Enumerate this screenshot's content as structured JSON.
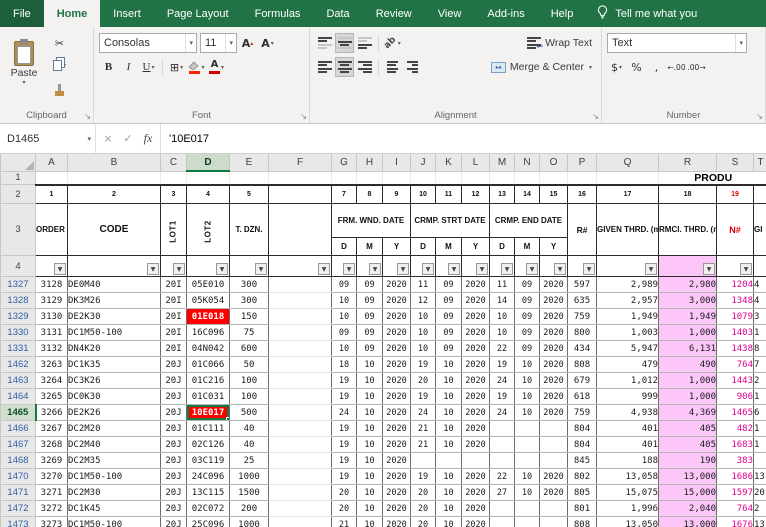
{
  "tabs": {
    "items": [
      "File",
      "Home",
      "Insert",
      "Page Layout",
      "Formulas",
      "Data",
      "Review",
      "View",
      "Add-ins",
      "Help"
    ],
    "active": "Home",
    "tell_me": "Tell me what you"
  },
  "ribbon": {
    "clipboard": {
      "label": "Clipboard",
      "paste": "Paste"
    },
    "font": {
      "label": "Font",
      "name": "Consolas",
      "size": "11",
      "bold": "B",
      "italic": "I",
      "underline": "U"
    },
    "alignment": {
      "label": "Alignment",
      "wrap": "Wrap Text",
      "merge": "Merge & Center"
    },
    "number": {
      "label": "Number",
      "format": "Text"
    }
  },
  "formula_bar": {
    "name_box": "D1465",
    "cancel": "×",
    "enter": "✓",
    "fx": "fx",
    "formula": "'10E017"
  },
  "icons": {
    "caret": "▾",
    "caret_up": "▴",
    "launcher": "↘",
    "cut": "✂",
    "borders": "⊞",
    "accounting": "$",
    "percent": "%",
    "comma": ",",
    "inc_decimal": "←.00",
    "dec_decimal": ".00→",
    "orientation": "ab",
    "filter": "▼",
    "merge_arrow": "↔",
    "inc_font": "A",
    "dec_font": "A"
  },
  "colors": {
    "excel_green": "#217346",
    "selection_green": "#107c41",
    "cell_fill_red": "#ff0000",
    "rmci_column_pink": "#fcc7f8",
    "n_column_magenta": "#e0008c",
    "filtered_row_number_blue": "#2e5fa3",
    "header_red": "#e10000"
  },
  "sheet": {
    "selected": {
      "col": "D",
      "row": "1465"
    },
    "title_partial": "PRODU",
    "header_row_nums": [
      "1",
      "2",
      "3",
      "4"
    ],
    "columns": [
      {
        "l": "A",
        "w": 32
      },
      {
        "l": "B",
        "w": 93
      },
      {
        "l": "C",
        "w": 26
      },
      {
        "l": "D",
        "w": 43
      },
      {
        "l": "E",
        "w": 39
      },
      {
        "l": "F",
        "w": 63
      },
      {
        "l": "G",
        "w": 25
      },
      {
        "l": "H",
        "w": 26
      },
      {
        "l": "I",
        "w": 28
      },
      {
        "l": "J",
        "w": 25
      },
      {
        "l": "K",
        "w": 26
      },
      {
        "l": "L",
        "w": 28
      },
      {
        "l": "M",
        "w": 25
      },
      {
        "l": "N",
        "w": 25
      },
      {
        "l": "O",
        "w": 28
      },
      {
        "l": "P",
        "w": 29
      },
      {
        "l": "Q",
        "w": 62
      },
      {
        "l": "R",
        "w": 58
      },
      {
        "l": "S",
        "w": 37
      },
      {
        "l": "T",
        "w": 14
      }
    ],
    "row2": [
      "1",
      "2",
      "3",
      "4",
      "5",
      "",
      "7",
      "8",
      "9",
      "10",
      "11",
      "12",
      "13",
      "14",
      "15",
      "16",
      "17",
      "18",
      "19",
      ""
    ],
    "headers": {
      "order": "ORDER\n№",
      "code": "CODE",
      "lot1": "LOT1",
      "lot2": "LOT2",
      "tdzn": "T.\nDZN.",
      "frm": "FRM. WND.\nDATE",
      "crmp_start": "CRMP. STRT\nDATE",
      "crmp_end": "CRMP. END\nDATE",
      "dmy": [
        "D",
        "M",
        "Y"
      ],
      "r": "R#",
      "given": "GIVEN\nTHRD.\n(m)",
      "rmci": "RMCI.\nTHRD.\n(m)",
      "n": "N#",
      "partial": "GI"
    },
    "rows": [
      {
        "num": "1327",
        "a": "3128",
        "b": "DE0M40",
        "c": "20I",
        "d": "05E010",
        "e": "300",
        "fw": [
          "09",
          "09",
          "2020"
        ],
        "cs": [
          "11",
          "09",
          "2020"
        ],
        "ce": [
          "11",
          "09",
          "2020"
        ],
        "p": "597",
        "q": "2,989",
        "r": "2,980",
        "s": "1204",
        "t": "4"
      },
      {
        "num": "1328",
        "a": "3129",
        "b": "DK3M26",
        "c": "20I",
        "d": "05K054",
        "e": "300",
        "fw": [
          "10",
          "09",
          "2020"
        ],
        "cs": [
          "12",
          "09",
          "2020"
        ],
        "ce": [
          "14",
          "09",
          "2020"
        ],
        "p": "635",
        "q": "2,957",
        "r": "3,000",
        "s": "1348",
        "t": "4"
      },
      {
        "num": "1329",
        "a": "3130",
        "b": "DE2K30",
        "c": "20I",
        "d": "01E018",
        "red": true,
        "e": "150",
        "fw": [
          "10",
          "09",
          "2020"
        ],
        "cs": [
          "10",
          "09",
          "2020"
        ],
        "ce": [
          "10",
          "09",
          "2020"
        ],
        "p": "759",
        "q": "1,949",
        "r": "1,949",
        "s": "1079",
        "t": "3"
      },
      {
        "num": "1330",
        "a": "3131",
        "b": "DC1M50-100",
        "c": "20I",
        "d": "16C096",
        "e": "75",
        "fw": [
          "09",
          "09",
          "2020"
        ],
        "cs": [
          "10",
          "09",
          "2020"
        ],
        "ce": [
          "10",
          "09",
          "2020"
        ],
        "p": "800",
        "q": "1,003",
        "r": "1,000",
        "s": "1403",
        "t": "1"
      },
      {
        "num": "1331",
        "a": "3132",
        "b": "DN4K20",
        "c": "20I",
        "d": "04N042",
        "e": "600",
        "fw": [
          "10",
          "09",
          "2020"
        ],
        "cs": [
          "10",
          "09",
          "2020"
        ],
        "ce": [
          "22",
          "09",
          "2020"
        ],
        "p": "434",
        "q": "5,947",
        "r": "6,131",
        "s": "1438",
        "t": "8"
      },
      {
        "num": "1462",
        "a": "3263",
        "b": "DC1K35",
        "c": "20J",
        "d": "01C066",
        "e": "50",
        "fw": [
          "18",
          "10",
          "2020"
        ],
        "cs": [
          "19",
          "10",
          "2020"
        ],
        "ce": [
          "19",
          "10",
          "2020"
        ],
        "p": "808",
        "q": "479",
        "r": "490",
        "s": "764",
        "t": "7"
      },
      {
        "num": "1463",
        "a": "3264",
        "b": "DC3K26",
        "c": "20J",
        "d": "01C216",
        "e": "100",
        "fw": [
          "19",
          "10",
          "2020"
        ],
        "cs": [
          "20",
          "10",
          "2020"
        ],
        "ce": [
          "24",
          "10",
          "2020"
        ],
        "p": "679",
        "q": "1,012",
        "r": "1,000",
        "s": "1443",
        "t": "2"
      },
      {
        "num": "1464",
        "a": "3265",
        "b": "DC0K30",
        "c": "20J",
        "d": "01C031",
        "e": "100",
        "fw": [
          "19",
          "10",
          "2020"
        ],
        "cs": [
          "19",
          "10",
          "2020"
        ],
        "ce": [
          "19",
          "10",
          "2020"
        ],
        "p": "618",
        "q": "999",
        "r": "1,000",
        "s": "906",
        "t": "1"
      },
      {
        "num": "1465",
        "a": "3266",
        "b": "DE2K26",
        "c": "20J",
        "d": "10E017",
        "red": true,
        "sel": true,
        "e": "500",
        "fw": [
          "24",
          "10",
          "2020"
        ],
        "cs": [
          "24",
          "10",
          "2020"
        ],
        "ce": [
          "24",
          "10",
          "2020"
        ],
        "p": "759",
        "q": "4,938",
        "r": "4,369",
        "s": "1465",
        "t": "6"
      },
      {
        "num": "1466",
        "a": "3267",
        "b": "DC2M20",
        "c": "20J",
        "d": "01C111",
        "e": "40",
        "fw": [
          "19",
          "10",
          "2020"
        ],
        "cs": [
          "21",
          "10",
          "2020"
        ],
        "ce": [
          "",
          "",
          ""
        ],
        "p": "804",
        "q": "401",
        "r": "405",
        "s": "482",
        "t": "1"
      },
      {
        "num": "1467",
        "a": "3268",
        "b": "DC2M40",
        "c": "20J",
        "d": "02C126",
        "e": "40",
        "fw": [
          "19",
          "10",
          "2020"
        ],
        "cs": [
          "21",
          "10",
          "2020"
        ],
        "ce": [
          "",
          "",
          ""
        ],
        "p": "804",
        "q": "401",
        "r": "405",
        "s": "1683",
        "t": "1"
      },
      {
        "num": "1468",
        "a": "3269",
        "b": "DC2M35",
        "c": "20J",
        "d": "03C119",
        "e": "25",
        "fw": [
          "19",
          "10",
          "2020"
        ],
        "cs": [
          "",
          "",
          ""
        ],
        "ce": [
          "",
          "",
          ""
        ],
        "p": "845",
        "q": "188",
        "r": "190",
        "s": "383",
        "t": ""
      },
      {
        "num": "1470",
        "a": "3270",
        "b": "DC1M50-100",
        "c": "20J",
        "d": "24C096",
        "e": "1000",
        "fw": [
          "19",
          "10",
          "2020"
        ],
        "cs": [
          "19",
          "10",
          "2020"
        ],
        "ce": [
          "22",
          "10",
          "2020"
        ],
        "p": "802",
        "q": "13,058",
        "r": "13,000",
        "s": "1686",
        "t": "13"
      },
      {
        "num": "1471",
        "a": "3271",
        "b": "DC2M30",
        "c": "20J",
        "d": "13C115",
        "e": "1500",
        "fw": [
          "20",
          "10",
          "2020"
        ],
        "cs": [
          "20",
          "10",
          "2020"
        ],
        "ce": [
          "27",
          "10",
          "2020"
        ],
        "p": "805",
        "q": "15,075",
        "r": "15,000",
        "s": "1597",
        "t": "20"
      },
      {
        "num": "1472",
        "a": "3272",
        "b": "DC1K45",
        "c": "20J",
        "d": "02C072",
        "e": "200",
        "fw": [
          "20",
          "10",
          "2020"
        ],
        "cs": [
          "20",
          "10",
          "2020"
        ],
        "ce": [
          "",
          "",
          ""
        ],
        "p": "801",
        "q": "1,996",
        "r": "2,040",
        "s": "764",
        "t": "2"
      },
      {
        "num": "1473",
        "a": "3273",
        "b": "DC1M50-100",
        "c": "20J",
        "d": "25C096",
        "e": "1000",
        "fw": [
          "21",
          "10",
          "2020"
        ],
        "cs": [
          "20",
          "10",
          "2020"
        ],
        "ce": [
          "",
          "",
          ""
        ],
        "p": "808",
        "q": "13,050",
        "r": "13,000",
        "s": "1676",
        "t": "13"
      }
    ]
  }
}
